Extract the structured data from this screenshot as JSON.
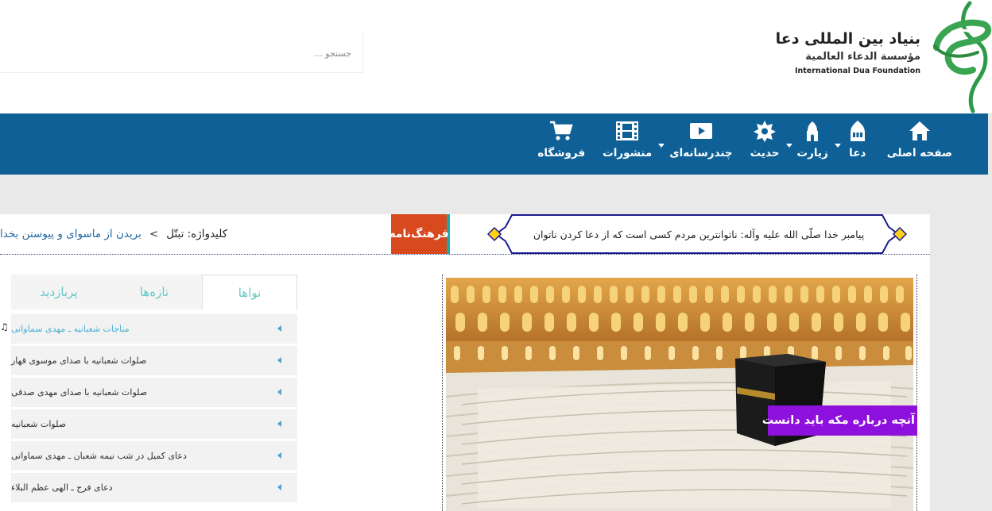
{
  "search": {
    "placeholder": "جستجو ..."
  },
  "logo": {
    "title": "بنیاد بین المللی دعا",
    "arabic": "مؤسسة الدعاء العالمية",
    "english": "International Dua Foundation"
  },
  "nav": {
    "items": [
      {
        "label": "صفحه اصلی",
        "icon": "home-icon"
      },
      {
        "label": "دعا",
        "icon": "mosque-icon"
      },
      {
        "label": "زیارت",
        "icon": "shrine-icon"
      },
      {
        "label": "حدیث",
        "icon": "star-icon"
      },
      {
        "label": "چندرسانه‌ای",
        "icon": "video-icon"
      },
      {
        "label": "منشورات",
        "icon": "film-icon"
      },
      {
        "label": "فروشگاه",
        "icon": "cart-icon"
      }
    ]
  },
  "hadith": {
    "text": "پیامبر خدا صلّی الله علیه وآله: ناتوانترین مردم کسی است که از دعا کردن ناتوان"
  },
  "farhangname": {
    "label": "فرهنگ‌نامه",
    "prefix": "کلیدواژه: تبتّل",
    "separator": ">",
    "link": "بریدن از ماسوای و پیوستن بخدا"
  },
  "tabs": {
    "items": [
      "نواها",
      "تازه‌ها",
      "پربازدید"
    ],
    "active": "نواها",
    "list": [
      "مناجات شعبانیه ـ مهدی سماواتی",
      "صلوات شعبانیه با صدای موسوی قهار",
      "صلوات شعبانیه با صدای مهدی صدقی",
      "صلوات شعبانیه",
      "دعای کمیل در شب نیمه شعبان ـ مهدی سماواتی",
      "دعای فرج ـ الهی عظم البلاء"
    ]
  },
  "feature": {
    "caption": "آنچه درباره مکه باید دانست"
  },
  "colors": {
    "nav_bg": "#0e6096",
    "farhang_bg": "#d8491e",
    "caption_bg": "#8e10dd",
    "tab_text": "#67c6c6",
    "link": "#1f6aa6"
  }
}
